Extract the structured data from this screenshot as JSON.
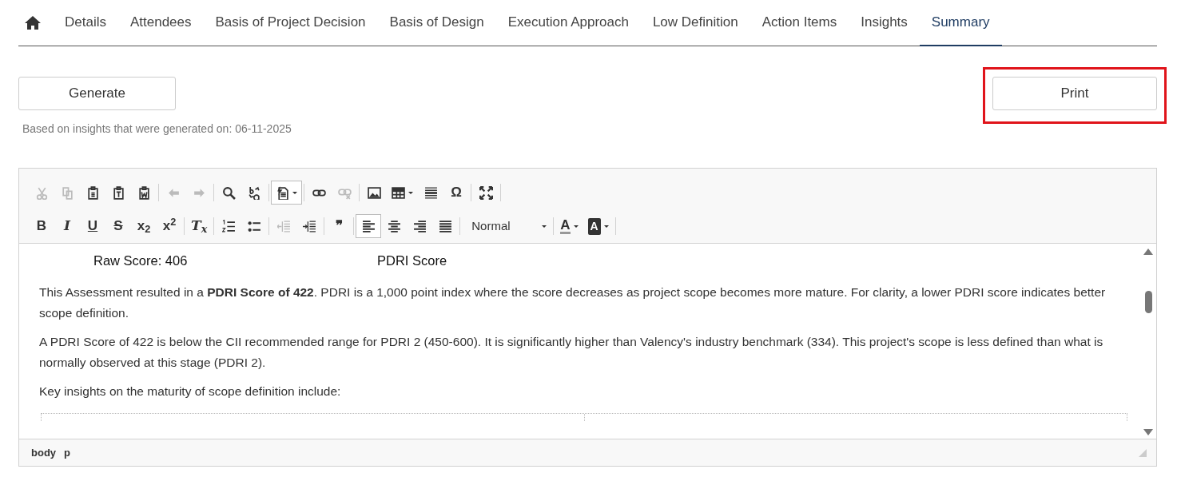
{
  "tabs": [
    {
      "kind": "home",
      "selected": false
    },
    {
      "label": "Details",
      "selected": false
    },
    {
      "label": "Attendees",
      "selected": false
    },
    {
      "label": "Basis of Project Decision",
      "selected": false
    },
    {
      "label": "Basis of Design",
      "selected": false
    },
    {
      "label": "Execution Approach",
      "selected": false
    },
    {
      "label": "Low Definition",
      "selected": false
    },
    {
      "label": "Action Items",
      "selected": false
    },
    {
      "label": "Insights",
      "selected": false
    },
    {
      "label": "Summary",
      "selected": true
    }
  ],
  "generate_button": {
    "label": "Generate"
  },
  "print_button": {
    "label": "Print",
    "highlighted": true
  },
  "generated_note": "Based on insights that were generated on: 06-11-2025",
  "editor": {
    "toolbar_rows": [
      [
        {
          "kind": "icon",
          "disabled": true,
          "selected": false
        },
        {
          "kind": "icon",
          "disabled": true,
          "selected": false
        },
        {
          "kind": "icon",
          "disabled": false,
          "selected": false
        },
        {
          "kind": "icon",
          "disabled": false,
          "selected": false
        },
        {
          "kind": "icon",
          "disabled": false,
          "selected": false
        },
        {
          "kind": "separator"
        },
        {
          "kind": "icon",
          "disabled": true,
          "selected": false
        },
        {
          "kind": "icon",
          "disabled": true,
          "selected": false
        },
        {
          "kind": "separator"
        },
        {
          "kind": "icon",
          "disabled": false,
          "selected": false
        },
        {
          "kind": "icon",
          "disabled": false,
          "selected": false
        },
        {
          "kind": "separator"
        },
        {
          "kind": "dropdown",
          "disabled": false,
          "selected": true
        },
        {
          "kind": "separator"
        },
        {
          "kind": "icon",
          "disabled": false,
          "selected": false
        },
        {
          "kind": "icon",
          "disabled": true,
          "selected": false
        },
        {
          "kind": "separator"
        },
        {
          "kind": "icon",
          "disabled": false,
          "selected": false
        },
        {
          "kind": "dropdown",
          "disabled": false,
          "selected": false
        },
        {
          "kind": "icon",
          "disabled": false,
          "selected": false
        },
        {
          "kind": "glyph",
          "label": "Ω",
          "disabled": false,
          "selected": false
        },
        {
          "kind": "separator"
        },
        {
          "kind": "icon",
          "disabled": false,
          "selected": false
        },
        {
          "kind": "separator"
        }
      ],
      [
        {
          "kind": "glyph",
          "label": "B",
          "disabled": false,
          "selected": false
        },
        {
          "kind": "glyph",
          "label": "I",
          "disabled": false,
          "selected": false
        },
        {
          "kind": "glyph",
          "label": "U",
          "disabled": false,
          "selected": false
        },
        {
          "kind": "glyph",
          "label": "S",
          "disabled": false,
          "selected": false
        },
        {
          "kind": "glyph",
          "label": "x$_{2}$",
          "disabled": false,
          "selected": false
        },
        {
          "kind": "glyph",
          "label": "x$^{2}$",
          "disabled": false,
          "selected": false
        },
        {
          "kind": "separator"
        },
        {
          "kind": "glyph",
          "label": "T$_{x}$",
          "disabled": false,
          "selected": false
        },
        {
          "kind": "separator"
        },
        {
          "kind": "icon",
          "disabled": false,
          "selected": false
        },
        {
          "kind": "icon",
          "disabled": false,
          "selected": false
        },
        {
          "kind": "separator"
        },
        {
          "kind": "icon",
          "disabled": true,
          "selected": false
        },
        {
          "kind": "icon",
          "disabled": false,
          "selected": false
        },
        {
          "kind": "separator"
        },
        {
          "kind": "glyph",
          "label": "❞",
          "disabled": false,
          "selected": false
        },
        {
          "kind": "separator"
        },
        {
          "kind": "icon",
          "disabled": false,
          "selected": true
        },
        {
          "kind": "icon",
          "disabled": false,
          "selected": false
        },
        {
          "kind": "icon",
          "disabled": false,
          "selected": false
        },
        {
          "kind": "icon",
          "disabled": false,
          "selected": false
        },
        {
          "kind": "separator"
        },
        {
          "kind": "combo",
          "label": "Normal"
        },
        {
          "kind": "separator"
        },
        {
          "kind": "color",
          "label": "A",
          "disabled": false,
          "selected": false
        },
        {
          "kind": "color",
          "label": "A",
          "disabled": false,
          "selected": false
        },
        {
          "kind": "separator"
        }
      ]
    ],
    "chart_labels": [
      "Raw Score: 406",
      "PDRI Score"
    ],
    "paragraphs": [
      "This Assessment resulted in a **PDRI Score of 422**. PDRI is a 1,000 point index where the score decreases as project scope becomes more mature. For clarity, a lower PDRI score indicates better scope definition.",
      "A PDRI Score of 422 is below the CII recommended range for PDRI 2 (450-600). It is significantly higher than Valency's industry benchmark (334). This project's scope is less defined than what is normally observed at this stage (PDRI 2).",
      "Key insights on the maturity of scope definition include:"
    ],
    "element_path": [
      "body",
      "p"
    ]
  }
}
